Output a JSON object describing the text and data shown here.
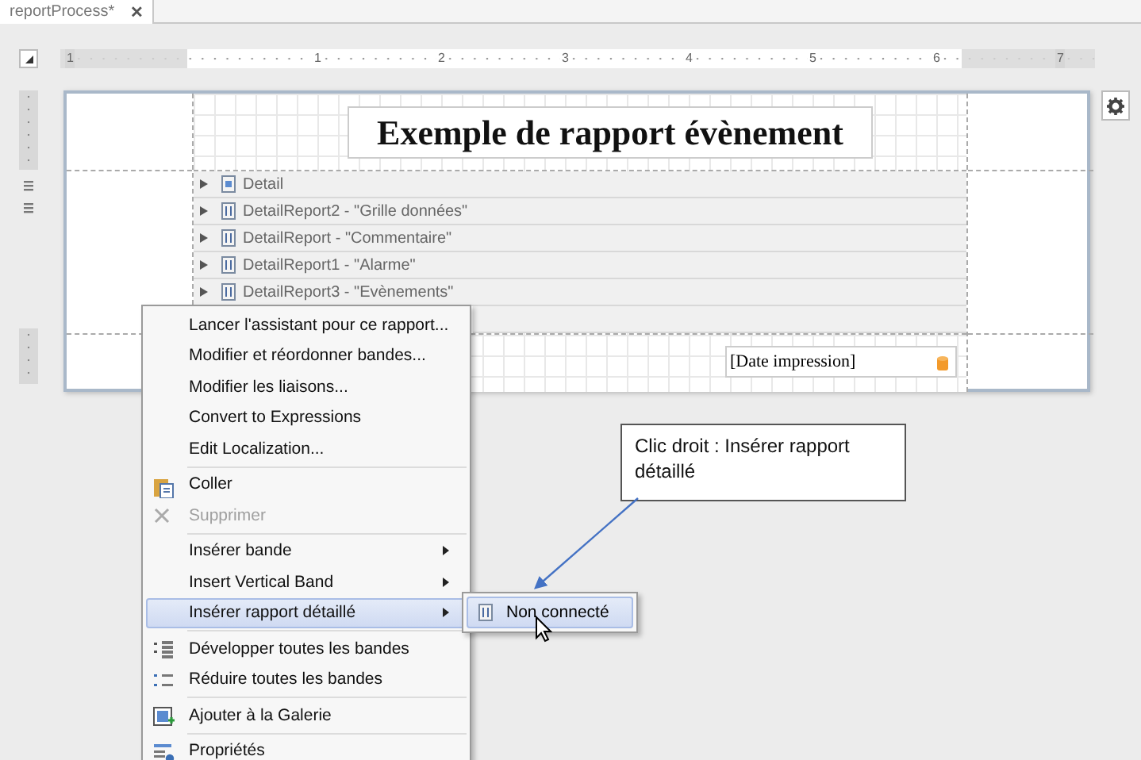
{
  "tabs": [
    {
      "label": "reportProcess*",
      "selected": true,
      "close": "✕"
    }
  ],
  "ruler": {
    "labels": [
      "1",
      "1",
      "2",
      "3",
      "4",
      "5",
      "6",
      "7"
    ]
  },
  "report": {
    "title": "Exemple de rapport évènement",
    "bands": [
      {
        "label": "Detail",
        "kind": "detail"
      },
      {
        "label": "DetailReport2 - \"Grille données\"",
        "kind": "report"
      },
      {
        "label": "DetailReport - \"Commentaire\"",
        "kind": "report"
      },
      {
        "label": "DetailReport1 - \"Alarme\"",
        "kind": "report"
      },
      {
        "label": "DetailReport3 - \"Evènements\"",
        "kind": "report"
      }
    ],
    "footer_field": "[Date impression]"
  },
  "context_menu": {
    "groups": [
      [
        {
          "label": "Lancer l'assistant pour ce rapport...",
          "disabled": false,
          "submenu": false,
          "selected": false
        },
        {
          "label": "Modifier et réordonner bandes...",
          "disabled": false,
          "submenu": false,
          "selected": false
        },
        {
          "label": "Modifier les liaisons...",
          "disabled": false,
          "submenu": false,
          "selected": false
        },
        {
          "label": "Convert to Expressions",
          "disabled": false,
          "submenu": false,
          "selected": false
        },
        {
          "label": "Edit Localization...",
          "disabled": false,
          "submenu": false,
          "selected": false
        }
      ],
      [
        {
          "label": "Coller",
          "disabled": false,
          "submenu": false,
          "selected": false
        },
        {
          "label": "Supprimer",
          "disabled": true,
          "submenu": false,
          "selected": false
        }
      ],
      [
        {
          "label": "Insérer bande",
          "disabled": false,
          "submenu": true,
          "selected": false
        },
        {
          "label": "Insert Vertical Band",
          "disabled": false,
          "submenu": true,
          "selected": false
        },
        {
          "label": "Insérer rapport détaillé",
          "disabled": false,
          "submenu": true,
          "selected": true
        }
      ],
      [
        {
          "label": "Développer toutes les bandes",
          "disabled": false,
          "submenu": false,
          "selected": false
        },
        {
          "label": "Réduire toutes les bandes",
          "disabled": false,
          "submenu": false,
          "selected": false
        }
      ],
      [
        {
          "label": "Ajouter à la Galerie",
          "disabled": false,
          "submenu": false,
          "selected": false
        }
      ],
      [
        {
          "label": "Propriétés",
          "disabled": false,
          "submenu": false,
          "selected": false
        }
      ]
    ]
  },
  "submenu": {
    "items": [
      {
        "label": "Non connecté",
        "selected": true
      }
    ]
  },
  "callout": {
    "text": "Clic droit : Insérer rapport détaillé"
  }
}
